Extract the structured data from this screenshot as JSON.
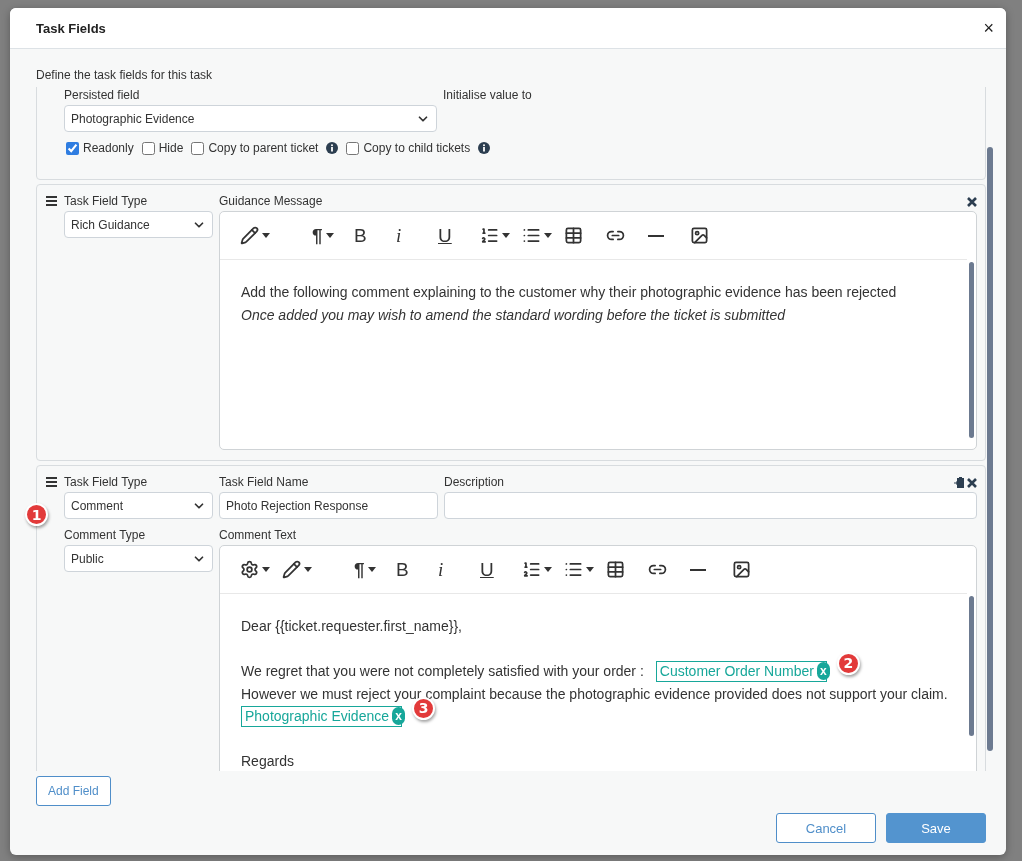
{
  "dialog": {
    "title": "Task Fields",
    "close": "×"
  },
  "intro": "Define the task fields for this task",
  "fields": [
    {
      "kind": "persisted",
      "field_label": "Persisted field",
      "init_label": "Initialise value to",
      "value": "Photographic Evidence",
      "options": [
        {
          "label": "Readonly",
          "checked": true,
          "info": false
        },
        {
          "label": "Hide",
          "checked": false,
          "info": false
        },
        {
          "label": "Copy to parent ticket",
          "checked": false,
          "info": true
        },
        {
          "label": "Copy to child tickets",
          "checked": false,
          "info": true
        }
      ]
    },
    {
      "kind": "guidance",
      "type_label": "Task Field Type",
      "type_value": "Rich Guidance",
      "message_label": "Guidance Message",
      "toolbar": [
        {
          "kind": "pen",
          "caret": true
        },
        {
          "kind": "paragraph",
          "text": "¶",
          "caret": true
        },
        {
          "kind": "bold",
          "text": "B",
          "caret": false
        },
        {
          "kind": "italic",
          "text": "i",
          "caret": false
        },
        {
          "kind": "underline",
          "text": "U",
          "caret": false
        },
        {
          "kind": "ol",
          "caret": true
        },
        {
          "kind": "ul",
          "caret": true
        },
        {
          "kind": "table",
          "caret": false
        },
        {
          "kind": "link",
          "caret": false
        },
        {
          "kind": "hr",
          "caret": false
        },
        {
          "kind": "image",
          "caret": false
        }
      ],
      "lines": [
        {
          "kind": "text",
          "segments": [
            {
              "kind": "text",
              "text": "Add the following comment explaining to the customer why their photographic evidence has been rejected",
              "italic": false
            }
          ]
        },
        {
          "kind": "text",
          "segments": [
            {
              "kind": "text",
              "text": "Once added you may wish to amend the standard wording before the ticket is submitted",
              "italic": true
            }
          ]
        }
      ]
    },
    {
      "kind": "comment",
      "annotation": "1",
      "type_label": "Task Field Type",
      "type_value": "Comment",
      "name_label": "Task Field Name",
      "name_value": "Photo Rejection Response",
      "desc_label": "Description",
      "comment_type_label": "Comment Type",
      "comment_type_value": "Public",
      "message_label": "Comment Text",
      "toolbar": [
        {
          "kind": "gear",
          "caret": true
        },
        {
          "kind": "pen",
          "caret": true
        },
        {
          "kind": "paragraph",
          "text": "¶",
          "caret": true
        },
        {
          "kind": "bold",
          "text": "B",
          "caret": false
        },
        {
          "kind": "italic",
          "text": "i",
          "caret": false
        },
        {
          "kind": "underline",
          "text": "U",
          "caret": false
        },
        {
          "kind": "ol",
          "caret": true
        },
        {
          "kind": "ul",
          "caret": true
        },
        {
          "kind": "table",
          "caret": false
        },
        {
          "kind": "link",
          "caret": false
        },
        {
          "kind": "hr",
          "caret": false
        },
        {
          "kind": "image",
          "caret": false
        }
      ],
      "lines": [
        {
          "kind": "text",
          "segments": [
            {
              "kind": "text",
              "text": "Dear {{ticket.requester.first_name}},",
              "italic": false
            }
          ]
        },
        {
          "kind": "blank"
        },
        {
          "kind": "text",
          "segments": [
            {
              "kind": "text",
              "text": "We regret that you were not completely satisfied with your order :",
              "italic": false
            },
            {
              "kind": "chip",
              "text": "Customer Order Number",
              "remove": "x",
              "annotation": "2"
            }
          ]
        },
        {
          "kind": "text",
          "segments": [
            {
              "kind": "text",
              "text": "However we must reject your complaint because the photographic evidence provided does not support your claim.",
              "italic": false
            }
          ]
        },
        {
          "kind": "text",
          "segments": [
            {
              "kind": "chip",
              "text": "Photographic Evidence",
              "remove": "x",
              "annotation": "3"
            }
          ]
        },
        {
          "kind": "blank"
        },
        {
          "kind": "text",
          "segments": [
            {
              "kind": "text",
              "text": "Regards",
              "italic": false
            }
          ]
        }
      ]
    }
  ],
  "add_field": "Add Field",
  "buttons": [
    {
      "label": "Cancel",
      "primary": false
    },
    {
      "label": "Save",
      "primary": true
    }
  ]
}
